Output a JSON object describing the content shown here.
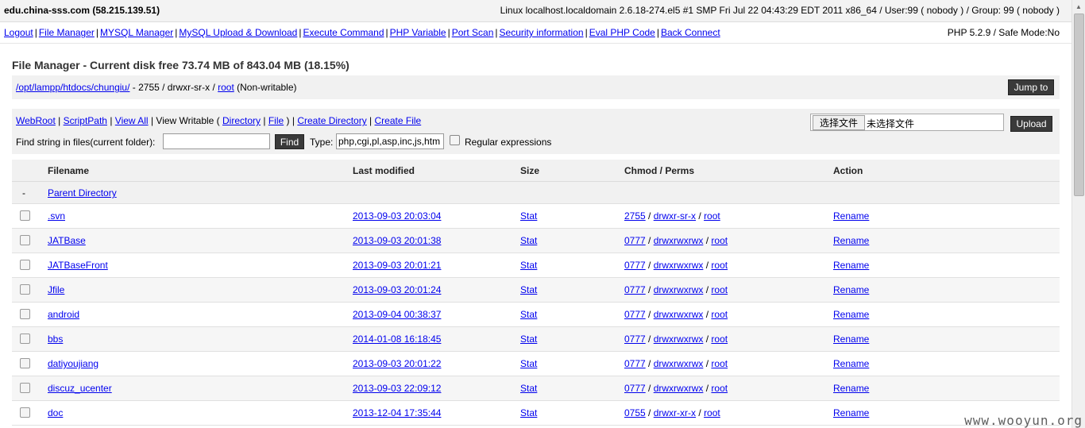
{
  "top": {
    "host": "edu.china-sss.com (58.215.139.51)",
    "sysinfo": "Linux localhost.localdomain 2.6.18-274.el5 #1 SMP Fri Jul 22 04:43:29 EDT 2011 x86_64 / User:99 ( nobody ) / Group: 99 ( nobody )"
  },
  "menu": {
    "items": [
      "Logout",
      "File Manager",
      "MYSQL Manager",
      "MySQL Upload & Download",
      "Execute Command",
      "PHP Variable",
      "Port Scan",
      "Security information",
      "Eval PHP Code",
      "Back Connect"
    ],
    "separator": "|",
    "php_info": "PHP 5.2.9 / Safe Mode:No"
  },
  "main": {
    "title": "File Manager - Current disk free 73.74 MB of 843.04 MB (18.15%)",
    "path": {
      "dir": "/opt/lampp/htdocs/chungiu/",
      "mid": " - 2755 / drwxr-sr-x / ",
      "owner": "root",
      "suffix": " (Non-writable)"
    },
    "jump_label": "Jump to",
    "links": {
      "webroot": "WebRoot",
      "scriptpath": "ScriptPath",
      "viewall": "View All",
      "viewwritable": "View Writable (",
      "directory": "Directory",
      "file": "File",
      "close": ")",
      "createdir": "Create Directory",
      "createfile": "Create File",
      "sep": "|"
    },
    "find": {
      "label": "Find string in files(current folder):",
      "value": "",
      "button": "Find",
      "type_label": "Type:",
      "type_value": "php,cgi,pl,asp,inc,js,htm",
      "regex_label": "Regular expressions"
    },
    "upload": {
      "choose_label": "选择文件",
      "nofile_label": "未选择文件",
      "button": "Upload"
    }
  },
  "table": {
    "headers": {
      "filename": "Filename",
      "modified": "Last modified",
      "size": "Size",
      "perms": "Chmod / Perms",
      "action": "Action"
    },
    "parent": {
      "marker": "-",
      "label": "Parent Directory"
    },
    "rows": [
      {
        "name": ".svn",
        "modified": "2013-09-03 20:03:04",
        "size": "Stat",
        "mode": "2755",
        "perm": "drwxr-sr-x",
        "owner": "root",
        "action": "Rename"
      },
      {
        "name": "JATBase",
        "modified": "2013-09-03 20:01:38",
        "size": "Stat",
        "mode": "0777",
        "perm": "drwxrwxrwx",
        "owner": "root",
        "action": "Rename"
      },
      {
        "name": "JATBaseFront",
        "modified": "2013-09-03 20:01:21",
        "size": "Stat",
        "mode": "0777",
        "perm": "drwxrwxrwx",
        "owner": "root",
        "action": "Rename"
      },
      {
        "name": "Jfile",
        "modified": "2013-09-03 20:01:24",
        "size": "Stat",
        "mode": "0777",
        "perm": "drwxrwxrwx",
        "owner": "root",
        "action": "Rename"
      },
      {
        "name": "android",
        "modified": "2013-09-04 00:38:37",
        "size": "Stat",
        "mode": "0777",
        "perm": "drwxrwxrwx",
        "owner": "root",
        "action": "Rename"
      },
      {
        "name": "bbs",
        "modified": "2014-01-08 16:18:45",
        "size": "Stat",
        "mode": "0777",
        "perm": "drwxrwxrwx",
        "owner": "root",
        "action": "Rename"
      },
      {
        "name": "datiyoujiang",
        "modified": "2013-09-03 20:01:22",
        "size": "Stat",
        "mode": "0777",
        "perm": "drwxrwxrwx",
        "owner": "root",
        "action": "Rename"
      },
      {
        "name": "discuz_ucenter",
        "modified": "2013-09-03 22:09:12",
        "size": "Stat",
        "mode": "0777",
        "perm": "drwxrwxrwx",
        "owner": "root",
        "action": "Rename"
      },
      {
        "name": "doc",
        "modified": "2013-12-04 17:35:44",
        "size": "Stat",
        "mode": "0755",
        "perm": "drwxr-xr-x",
        "owner": "root",
        "action": "Rename"
      }
    ]
  },
  "watermark": "www.wooyun.org"
}
